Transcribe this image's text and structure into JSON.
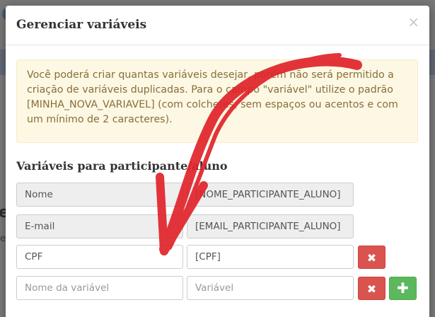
{
  "modal": {
    "title": "Gerenciar variáveis",
    "close_icon": "×"
  },
  "alert": {
    "text": "Você poderá criar quantas variáveis desejar, porém não será permitido a criação de variáveis duplicadas. Para o campo \"variável\" utilize o padrão [MINHA_NOVA_VARIAVEL] (com colchetes, sem espaços ou acentos e com um mínimo de 2 caracteres)."
  },
  "section": {
    "title": "Variáveis para participante/aluno"
  },
  "variables": [
    {
      "name": "Nome",
      "value": "[NOME_PARTICIPANTE_ALUNO]",
      "readonly": true
    },
    {
      "name": "E-mail",
      "value": "[EMAIL_PARTICIPANTE_ALUNO]",
      "readonly": true
    },
    {
      "name": "CPF",
      "value": "[CPF]",
      "readonly": false
    }
  ],
  "new_variable": {
    "name_placeholder": "Nome da variável",
    "value_placeholder": "Variável"
  },
  "buttons": {
    "delete_icon": "✖",
    "add_icon": "✚"
  },
  "background": {
    "heading_fragment": "e",
    "text_fragment": "e"
  },
  "colors": {
    "alert_bg": "#fcf8e3",
    "alert_text": "#8a6d3b",
    "danger": "#d9534f",
    "success": "#5cb85c",
    "annotation_arrow": "#e0242a"
  }
}
